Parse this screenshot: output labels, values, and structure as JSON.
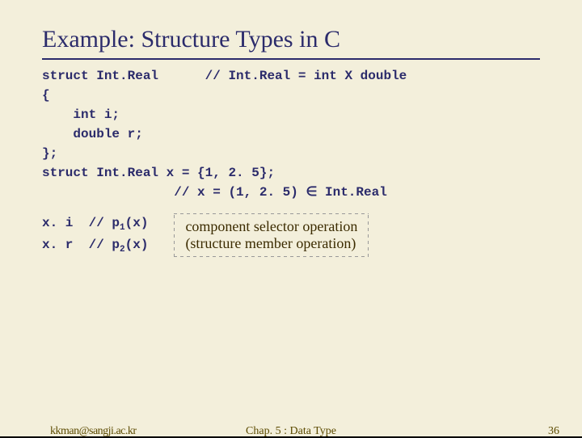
{
  "title": "Example: Structure Types in C",
  "code": {
    "l1a": "struct Int.Real",
    "l1b": "// Int.Real = int X double",
    "l2": "{",
    "l3": "    int i;",
    "l4": "    double r;",
    "l5": "};",
    "l6": "struct Int.Real x = {1, 2. 5};",
    "l7": "                 // x = (1, 2. 5) ∈ Int.Real"
  },
  "selector": {
    "l1a": "x. i",
    "l1b": "// p",
    "l1c": "1",
    "l1d": "(x)",
    "l2a": "x. r",
    "l2b": "// p",
    "l2c": "2",
    "l2d": "(x)"
  },
  "annot": {
    "line1": "component selector operation",
    "line2": "(structure member operation)"
  },
  "footer": {
    "email": "kkman@sangji.ac.kr",
    "chap": "Chap. 5 : Data Type",
    "page": "36"
  }
}
